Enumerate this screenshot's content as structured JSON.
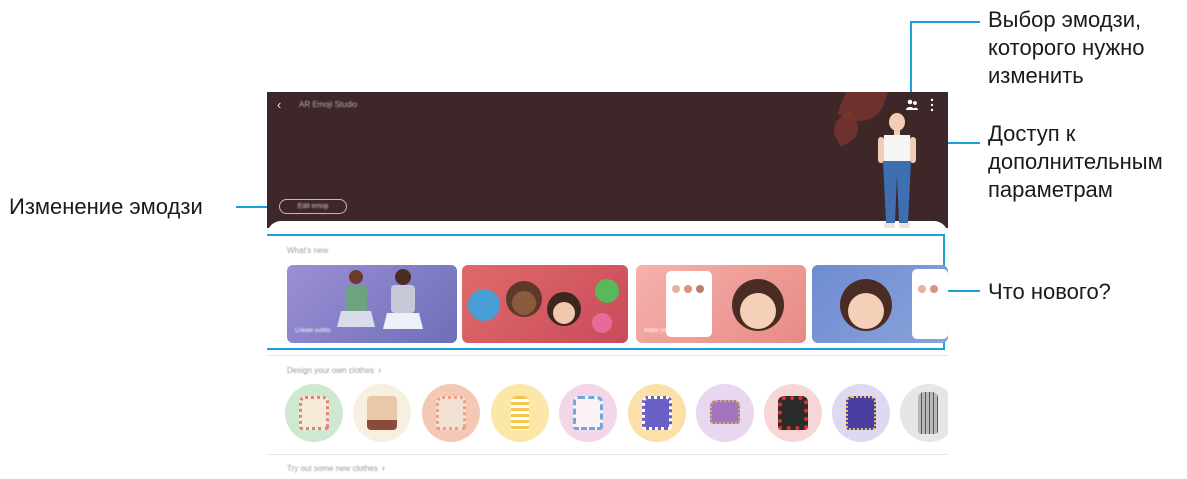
{
  "annotations": {
    "select_emoji": [
      "Выбор эмодзи,",
      "которого нужно",
      "изменить"
    ],
    "more_options": [
      "Доступ к",
      "дополнительным",
      "параметрам"
    ],
    "edit_emoji": "Изменение эмодзи",
    "whats_new": "Что нового?"
  },
  "screen": {
    "title": "AR Emoji Studio",
    "edit_chip": "Edit emoji",
    "whats_new_label": "What's new",
    "cards": [
      {
        "caption": "Create outfits",
        "colors": [
          "#9b8fd6",
          "#6e6fb8"
        ]
      },
      {
        "caption": "",
        "colors": [
          "#e06a6a",
          "#c94b5b"
        ]
      },
      {
        "caption": "Make your face",
        "colors": [
          "#f3a5a0",
          "#e78a87"
        ]
      },
      {
        "caption": "",
        "colors": [
          "#6d8cd1",
          "#8aa3db"
        ]
      }
    ],
    "design_label": "Design your own clothes",
    "more_label": "Try out some new clothes",
    "stickers": [
      {
        "bg": "#cfe8d0",
        "cloth": "#f4ecd8",
        "accent": "#e47f7f"
      },
      {
        "bg": "#f7f0e0",
        "cloth": "#e8c8a8",
        "accent": "#8b4b3b"
      },
      {
        "bg": "#f5c8b6",
        "cloth": "#f3e2d4",
        "accent": "#e6a27e"
      },
      {
        "bg": "#fbe7a8",
        "cloth": "#f6c64c",
        "accent": "#ffffff"
      },
      {
        "bg": "#f3d6e8",
        "cloth": "#fbf2f6",
        "accent": "#6fa8d9"
      },
      {
        "bg": "#fde0a8",
        "cloth": "#6b5fc8",
        "accent": "#ffffff"
      },
      {
        "bg": "#e8d7ee",
        "cloth": "#a374c0",
        "accent": "#d6b54e"
      },
      {
        "bg": "#f6d6d6",
        "cloth": "#2b2b2b",
        "accent": "#d9322f"
      },
      {
        "bg": "#dcd9f1",
        "cloth": "#4a3ea3",
        "accent": "#f2c94c"
      },
      {
        "bg": "#e6e6e6",
        "cloth": "#b9b9b9",
        "accent": "#555555"
      }
    ]
  },
  "colors": {
    "accent_line": "#1d9fd8",
    "header_bg": "#3d2729"
  }
}
